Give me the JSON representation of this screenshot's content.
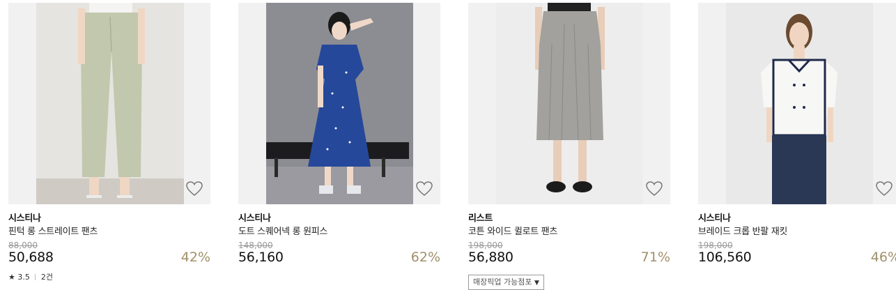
{
  "products": [
    {
      "brand": "시스티나",
      "name": "핀턱 롱 스트레이트 팬츠",
      "original_price": "88,000",
      "price": "50,688",
      "discount": "42%",
      "rating": {
        "star": "★",
        "score": "3.5",
        "count": "2건"
      },
      "wishlist_icon": "heart-outline-icon"
    },
    {
      "brand": "시스티나",
      "name": "도트 스퀘어넥 롱 원피스",
      "original_price": "148,000",
      "price": "56,160",
      "discount": "62%",
      "wishlist_icon": "heart-outline-icon"
    },
    {
      "brand": "리스트",
      "name": "코튼 와이드 퀼로트 팬츠",
      "original_price": "198,000",
      "price": "56,880",
      "discount": "71%",
      "pickup_label": "매장픽업 가능점포",
      "wishlist_icon": "heart-outline-icon"
    },
    {
      "brand": "시스티나",
      "name": "브레이드 크롭 반팔 재킷",
      "original_price": "198,000",
      "price": "106,560",
      "discount": "46%",
      "wishlist_icon": "heart-outline-icon"
    }
  ],
  "colors": {
    "discount": "#a18f6a",
    "image_bg": "#f1f1f1"
  }
}
